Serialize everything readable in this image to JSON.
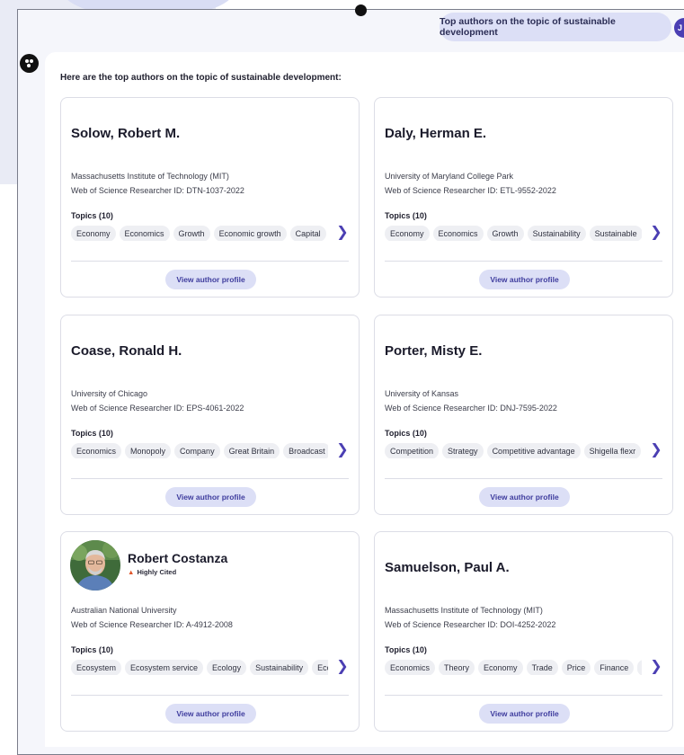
{
  "chat": {
    "query": "Top authors on the topic of sustainable development",
    "user_initial": "J",
    "intro": "Here are the top authors on the topic of sustainable development:"
  },
  "labels": {
    "view_profile": "View author profile"
  },
  "authors": [
    {
      "name": "Solow, Robert M.",
      "affiliation": "Massachusetts Institute of Technology (MIT)",
      "researcher_id": "Web of Science Researcher ID: DTN-1037-2022",
      "topics_label": "Topics (10)",
      "topics": [
        "Economy",
        "Economics",
        "Growth",
        "Economic growth",
        "Capital"
      ]
    },
    {
      "name": "Daly, Herman E.",
      "affiliation": "University of Maryland College Park",
      "researcher_id": "Web of Science Researcher ID: ETL-9552-2022",
      "topics_label": "Topics (10)",
      "topics": [
        "Economy",
        "Economics",
        "Growth",
        "Sustainability",
        "Sustainable"
      ]
    },
    {
      "name": "Coase, Ronald H.",
      "affiliation": "University of Chicago",
      "researcher_id": "Web of Science Researcher ID: EPS-4061-2022",
      "topics_label": "Topics (10)",
      "topics": [
        "Economics",
        "Monopoly",
        "Company",
        "Great Britain",
        "Broadcast"
      ]
    },
    {
      "name": "Porter, Misty E.",
      "affiliation": "University of Kansas",
      "researcher_id": "Web of Science Researcher ID: DNJ-7595-2022",
      "topics_label": "Topics (10)",
      "topics": [
        "Competition",
        "Strategy",
        "Competitive advantage",
        "Shigella flexr"
      ]
    },
    {
      "name": "Robert Costanza",
      "badge": "Highly Cited",
      "affiliation": "Australian National University",
      "researcher_id": "Web of Science Researcher ID: A-4912-2008",
      "topics_label": "Topics (10)",
      "topics": [
        "Ecosystem",
        "Ecosystem service",
        "Ecology",
        "Sustainability",
        "Ecc"
      ]
    },
    {
      "name": "Samuelson, Paul A.",
      "affiliation": "Massachusetts Institute of Technology (MIT)",
      "researcher_id": "Web of Science Researcher ID: DOI-4252-2022",
      "topics_label": "Topics (10)",
      "topics": [
        "Economics",
        "Theory",
        "Economy",
        "Trade",
        "Price",
        "Finance",
        ""
      ]
    }
  ]
}
